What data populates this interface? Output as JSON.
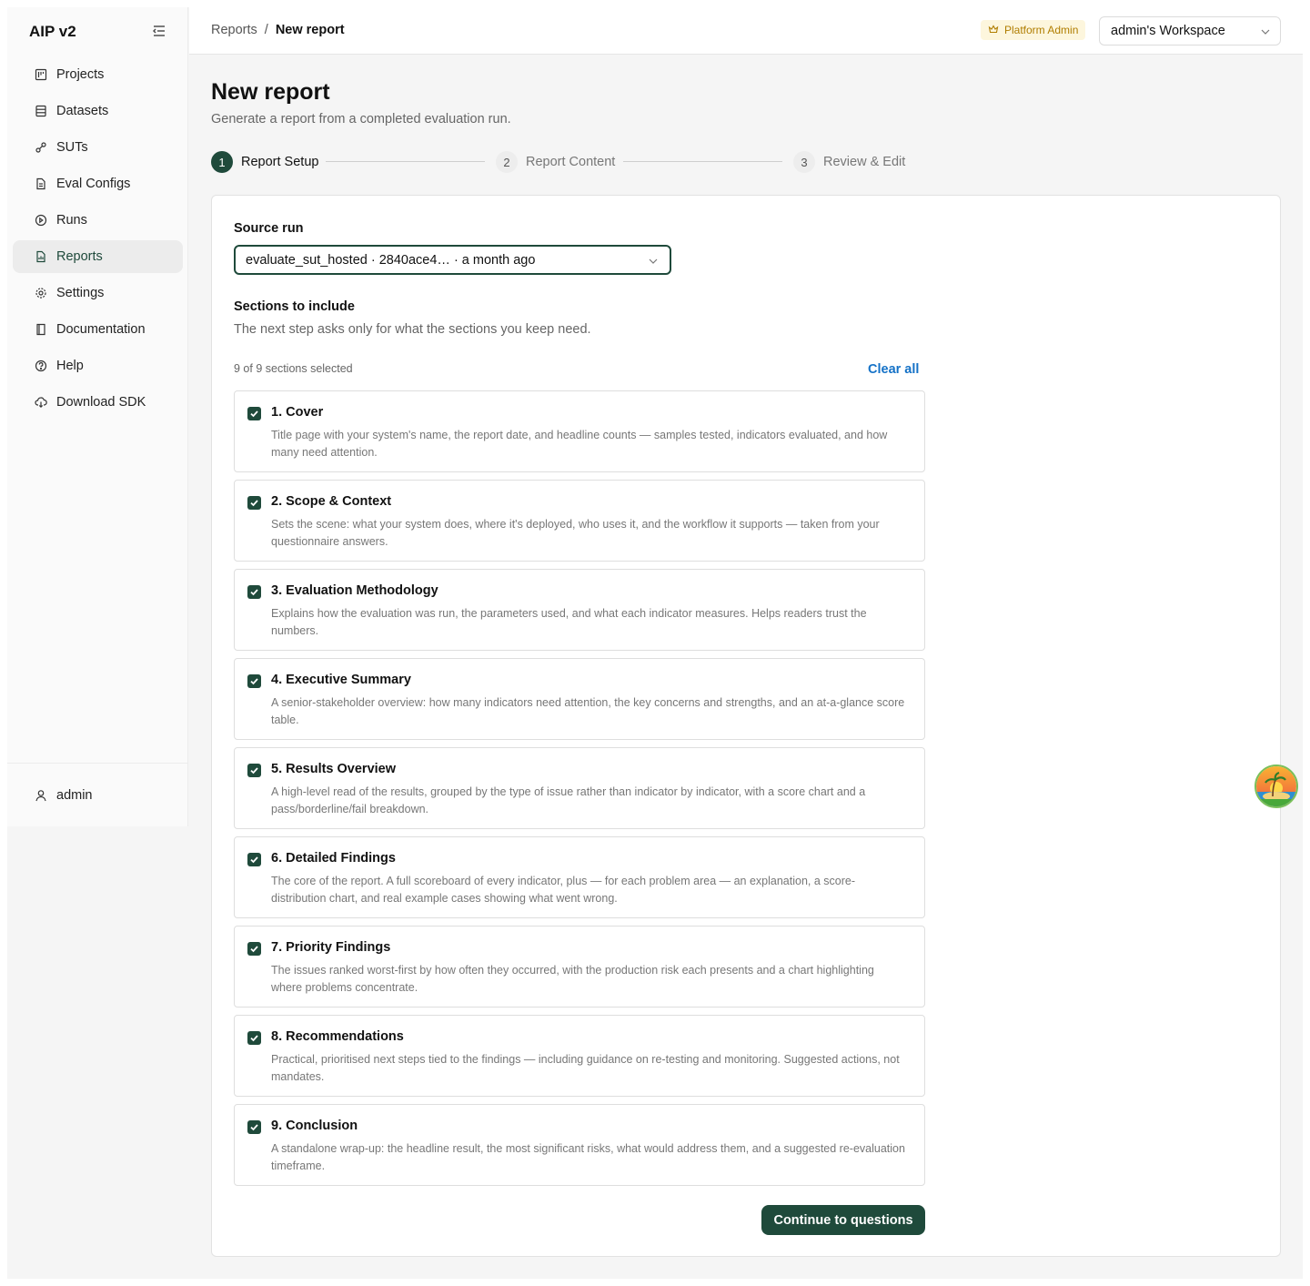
{
  "sidebar": {
    "brand": "AIP v2",
    "items": [
      {
        "label": "Projects",
        "icon": "projects-icon"
      },
      {
        "label": "Datasets",
        "icon": "datasets-icon"
      },
      {
        "label": "SUTs",
        "icon": "suts-icon"
      },
      {
        "label": "Eval Configs",
        "icon": "file-icon"
      },
      {
        "label": "Runs",
        "icon": "play-icon"
      },
      {
        "label": "Reports",
        "icon": "report-icon"
      },
      {
        "label": "Settings",
        "icon": "gear-icon"
      },
      {
        "label": "Documentation",
        "icon": "book-icon"
      },
      {
        "label": "Help",
        "icon": "help-icon"
      },
      {
        "label": "Download SDK",
        "icon": "cloud-download-icon"
      }
    ],
    "active": "Reports",
    "user": "admin"
  },
  "topbar": {
    "breadcrumb_parent": "Reports",
    "breadcrumb_sep": "/",
    "breadcrumb_current": "New report",
    "role_badge": "Platform Admin",
    "workspace": "admin's Workspace"
  },
  "page": {
    "title": "New report",
    "subtitle": "Generate a report from a completed evaluation run."
  },
  "steps": [
    {
      "num": "1",
      "label": "Report Setup",
      "state": "active"
    },
    {
      "num": "2",
      "label": "Report Content",
      "state": "inactive"
    },
    {
      "num": "3",
      "label": "Review & Edit",
      "state": "inactive"
    }
  ],
  "form": {
    "source_label": "Source run",
    "source_value": "evaluate_sut_hosted · 2840ace4… · a month ago",
    "sections_label": "Sections to include",
    "sections_helper": "The next step asks only for what the sections you keep need.",
    "count_text": "9 of 9 sections selected",
    "clear_all": "Clear all",
    "continue_label": "Continue to questions"
  },
  "sections": [
    {
      "title": "1. Cover",
      "checked": true,
      "desc": "Title page with your system's name, the report date, and headline counts — samples tested, indicators evaluated, and how many need attention."
    },
    {
      "title": "2. Scope & Context",
      "checked": true,
      "desc": "Sets the scene: what your system does, where it's deployed, who uses it, and the workflow it supports — taken from your questionnaire answers."
    },
    {
      "title": "3. Evaluation Methodology",
      "checked": true,
      "desc": "Explains how the evaluation was run, the parameters used, and what each indicator measures. Helps readers trust the numbers."
    },
    {
      "title": "4. Executive Summary",
      "checked": true,
      "desc": "A senior-stakeholder overview: how many indicators need attention, the key concerns and strengths, and an at-a-glance score table."
    },
    {
      "title": "5. Results Overview",
      "checked": true,
      "desc": "A high-level read of the results, grouped by the type of issue rather than indicator by indicator, with a score chart and a pass/borderline/fail breakdown."
    },
    {
      "title": "6. Detailed Findings",
      "checked": true,
      "desc": "The core of the report. A full scoreboard of every indicator, plus — for each problem area — an explanation, a score-distribution chart, and real example cases showing what went wrong."
    },
    {
      "title": "7. Priority Findings",
      "checked": true,
      "desc": "The issues ranked worst-first by how often they occurred, with the production risk each presents and a chart highlighting where problems concentrate."
    },
    {
      "title": "8. Recommendations",
      "checked": true,
      "desc": "Practical, prioritised next steps tied to the findings — including guidance on re-testing and monitoring. Suggested actions, not mandates."
    },
    {
      "title": "9. Conclusion",
      "checked": true,
      "desc": "A standalone wrap-up: the headline result, the most significant risks, what would address them, and a suggested re-evaluation timeframe."
    }
  ],
  "colors": {
    "accent": "#1f4a3b",
    "link": "#1572c7",
    "badge_bg": "#fdf6dd",
    "badge_fg": "#b07d00"
  }
}
